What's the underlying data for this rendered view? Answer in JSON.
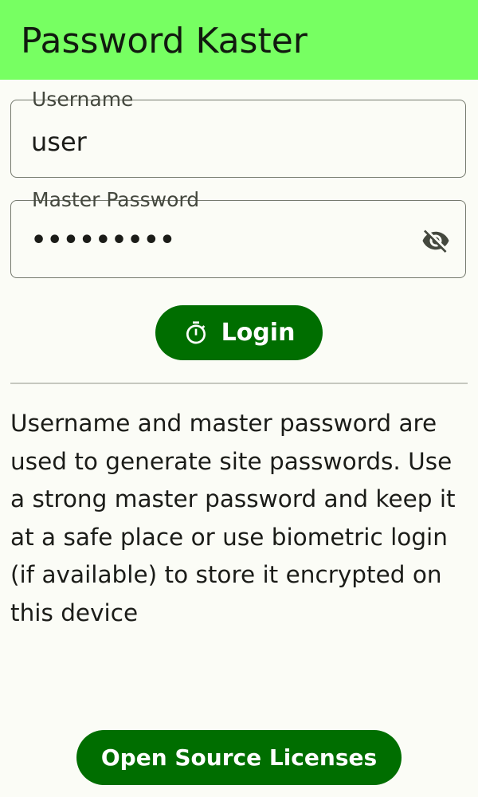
{
  "app_bar": {
    "title": "Password Kaster",
    "background": "#77ff62"
  },
  "username_field": {
    "label": "Username",
    "value": "user"
  },
  "password_field": {
    "label": "Master Password",
    "value_masked": "•••••••••",
    "toggle_icon": "visibility-off-icon"
  },
  "login_button": {
    "label": "Login",
    "icon": "timer-icon",
    "color": "#006e00"
  },
  "info": {
    "text": "Username and master password are used to generate site passwords. Use a strong master password and keep it at a safe place or use biometric login (if available) to store it encrypted on this device"
  },
  "licenses_button": {
    "label": "Open Source Licenses",
    "color": "#006e00"
  }
}
